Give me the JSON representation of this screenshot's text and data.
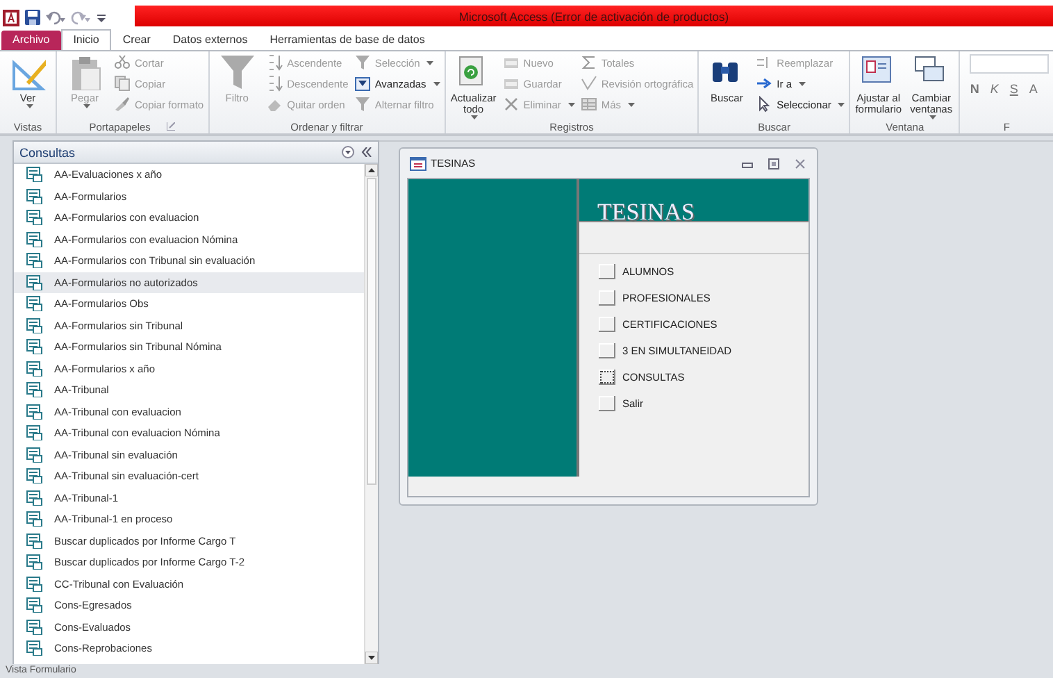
{
  "window": {
    "title": "Microsoft Access (Error de activación de productos)"
  },
  "tabs": [
    {
      "label": "Archivo",
      "kind": "file",
      "selected": false
    },
    {
      "label": "Inicio",
      "kind": "tab",
      "selected": true
    },
    {
      "label": "Crear",
      "kind": "tab",
      "selected": false
    },
    {
      "label": "Datos externos",
      "kind": "tab",
      "selected": false
    },
    {
      "label": "Herramientas de base de datos",
      "kind": "tab",
      "selected": false
    }
  ],
  "ribbon": {
    "groups": [
      {
        "label": "Vistas",
        "big": [
          {
            "label": "Ver",
            "dropdown": true,
            "disabled": false
          }
        ]
      },
      {
        "label": "Portapapeles",
        "launcher": true,
        "big": [
          {
            "label": "Pegar",
            "dropdown": true,
            "disabled": true
          }
        ],
        "columns": [
          [
            {
              "label": "Cortar",
              "dropdown": false,
              "disabled": true
            },
            {
              "label": "Copiar",
              "dropdown": false,
              "disabled": true
            },
            {
              "label": "Copiar formato",
              "dropdown": false,
              "disabled": true
            }
          ]
        ]
      },
      {
        "label": "Ordenar y filtrar",
        "big": [
          {
            "label": "Filtro",
            "dropdown": false,
            "disabled": true
          }
        ],
        "columns": [
          [
            {
              "label": "Ascendente",
              "dropdown": false,
              "disabled": true
            },
            {
              "label": "Descendente",
              "dropdown": false,
              "disabled": true
            },
            {
              "label": "Quitar orden",
              "dropdown": false,
              "disabled": true
            }
          ],
          [
            {
              "label": "Selección",
              "dropdown": true,
              "disabled": true
            },
            {
              "label": "Avanzadas",
              "dropdown": true,
              "disabled": false
            },
            {
              "label": "Alternar filtro",
              "dropdown": false,
              "disabled": true
            }
          ]
        ]
      },
      {
        "label": "Registros",
        "big": [
          {
            "label": "Actualizar todo",
            "dropdown": true,
            "disabled": false
          }
        ],
        "columns": [
          [
            {
              "label": "Nuevo",
              "dropdown": false,
              "disabled": true
            },
            {
              "label": "Guardar",
              "dropdown": false,
              "disabled": true
            },
            {
              "label": "Eliminar",
              "dropdown": true,
              "disabled": true
            }
          ],
          [
            {
              "label": "Totales",
              "dropdown": false,
              "disabled": true
            },
            {
              "label": "Revisión ortográfica",
              "dropdown": false,
              "disabled": true
            },
            {
              "label": "Más",
              "dropdown": true,
              "disabled": true
            }
          ]
        ]
      },
      {
        "label": "Buscar",
        "big": [
          {
            "label": "Buscar",
            "dropdown": false,
            "disabled": false
          }
        ],
        "columns": [
          [
            {
              "label": "Reemplazar",
              "dropdown": false,
              "disabled": true
            },
            {
              "label": "Ir a",
              "dropdown": true,
              "disabled": false
            },
            {
              "label": "Seleccionar",
              "dropdown": true,
              "disabled": false
            }
          ]
        ]
      },
      {
        "label": "Ventana",
        "big": [
          {
            "label": "Ajustar al formulario",
            "dropdown": false,
            "disabled": false
          },
          {
            "label": "Cambiar ventanas",
            "dropdown": true,
            "disabled": false
          }
        ]
      },
      {
        "label": "F",
        "font_buttons": [
          "N",
          "K",
          "S",
          "A"
        ]
      }
    ]
  },
  "navigation": {
    "header": "Consultas",
    "items": [
      {
        "label": "AA-Evaluaciones x año",
        "selected": false
      },
      {
        "label": "AA-Formularios",
        "selected": false
      },
      {
        "label": "AA-Formularios con evaluacion",
        "selected": false
      },
      {
        "label": "AA-Formularios con evaluacion Nómina",
        "selected": false
      },
      {
        "label": "AA-Formularios con Tribunal sin evaluación",
        "selected": false
      },
      {
        "label": "AA-Formularios no autorizados",
        "selected": true
      },
      {
        "label": "AA-Formularios Obs",
        "selected": false
      },
      {
        "label": "AA-Formularios sin Tribunal",
        "selected": false
      },
      {
        "label": "AA-Formularios sin Tribunal Nómina",
        "selected": false
      },
      {
        "label": "AA-Formularios x año",
        "selected": false
      },
      {
        "label": "AA-Tribunal",
        "selected": false
      },
      {
        "label": "AA-Tribunal con evaluacion",
        "selected": false
      },
      {
        "label": "AA-Tribunal con evaluacion Nómina",
        "selected": false
      },
      {
        "label": "AA-Tribunal sin evaluación",
        "selected": false
      },
      {
        "label": "AA-Tribunal sin evaluación-cert",
        "selected": false
      },
      {
        "label": "AA-Tribunal-1",
        "selected": false
      },
      {
        "label": "AA-Tribunal-1 en proceso",
        "selected": false
      },
      {
        "label": "Buscar duplicados por Informe Cargo T",
        "selected": false
      },
      {
        "label": "Buscar duplicados por Informe Cargo T-2",
        "selected": false
      },
      {
        "label": "CC-Tribunal con Evaluación",
        "selected": false
      },
      {
        "label": "Cons-Egresados",
        "selected": false
      },
      {
        "label": "Cons-Evaluados",
        "selected": false
      },
      {
        "label": "Cons-Reprobaciones",
        "selected": false
      }
    ]
  },
  "form": {
    "title": "TESINAS",
    "heading": "TESINAS",
    "buttons": [
      {
        "label": "ALUMNOS",
        "focused": false
      },
      {
        "label": "PROFESIONALES",
        "focused": false
      },
      {
        "label": "CERTIFICACIONES",
        "focused": false
      },
      {
        "label": "3 EN SIMULTANEIDAD",
        "focused": false
      },
      {
        "label": "CONSULTAS",
        "focused": true
      },
      {
        "label": "Salir",
        "focused": false
      }
    ]
  },
  "status_bar": {
    "text": "Vista Formulario"
  }
}
